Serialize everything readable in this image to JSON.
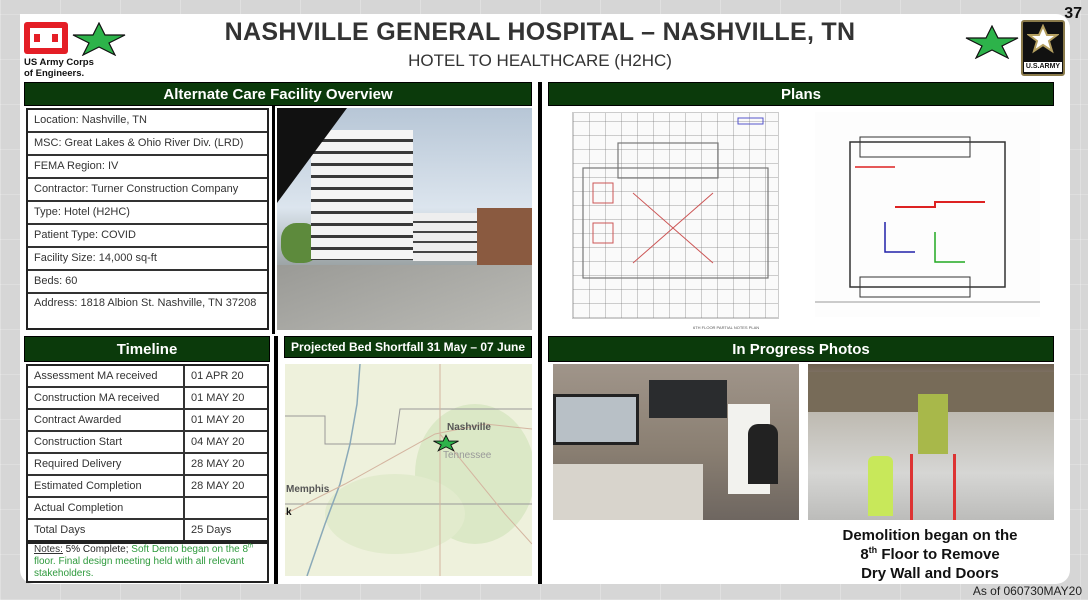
{
  "page_number": "37",
  "as_of": "As of 060730MAY20",
  "header": {
    "title": "NASHVILLE GENERAL HOSPITAL – NASHVILLE, TN",
    "subtitle": "HOTEL TO HEALTHCARE (H2HC)",
    "left_logo_text_line1": "US Army Corps",
    "left_logo_text_line2": "of Engineers.",
    "right_logo_text": "U.S.ARMY",
    "star_color": "#2db34a"
  },
  "overview": {
    "heading": "Alternate Care Facility Overview",
    "rows": [
      "Location: Nashville, TN",
      "MSC: Great Lakes & Ohio River Div. (LRD)",
      "FEMA Region:  IV",
      "Contractor: Turner Construction Company",
      "Type:  Hotel (H2HC)",
      "Patient Type:  COVID",
      "Facility Size:  14,000 sq-ft",
      "Beds: 60",
      "Address: 1818 Albion St. Nashville, TN 37208"
    ],
    "photo_alt": "Nashville General Hospital building photo"
  },
  "timeline": {
    "heading": "Timeline",
    "rows": [
      {
        "label": "Assessment MA received",
        "value": "01 APR 20"
      },
      {
        "label": "Construction MA received",
        "value": "01 MAY 20"
      },
      {
        "label": "Contract Awarded",
        "value": "01 MAY 20"
      },
      {
        "label": "Construction Start",
        "value": "04 MAY 20"
      },
      {
        "label": "Required Delivery",
        "value": "28 MAY 20"
      },
      {
        "label": "Estimated Completion",
        "value": "28 MAY 20"
      },
      {
        "label": "Actual Completion",
        "value": ""
      },
      {
        "label": "Total Days",
        "value": "25 Days"
      }
    ],
    "notes_label": "Notes:",
    "notes_black": " 5% Complete; ",
    "notes_green_a": "Soft Demo began on the 8",
    "notes_green_sup": "th",
    "notes_green_b": " floor. Final design meeting held with all relevant stakeholders."
  },
  "map": {
    "heading": "Projected Bed Shortfall 31 May – 07 June",
    "labels": {
      "nashville": "Nashville",
      "tennessee": "Tennessee",
      "memphis": "Memphis",
      "edge": "k"
    }
  },
  "plans": {
    "heading": "Plans",
    "plan_caption": "6TH FLOOR PARTIAL NOTES PLAN"
  },
  "photos": {
    "heading": "In Progress Photos",
    "caption_line1": "Demolition began on the",
    "caption_line2_num": "8",
    "caption_line2_sup": "th",
    "caption_line2_rest": " Floor to Remove",
    "caption_line3": "Dry Wall and Doors"
  }
}
